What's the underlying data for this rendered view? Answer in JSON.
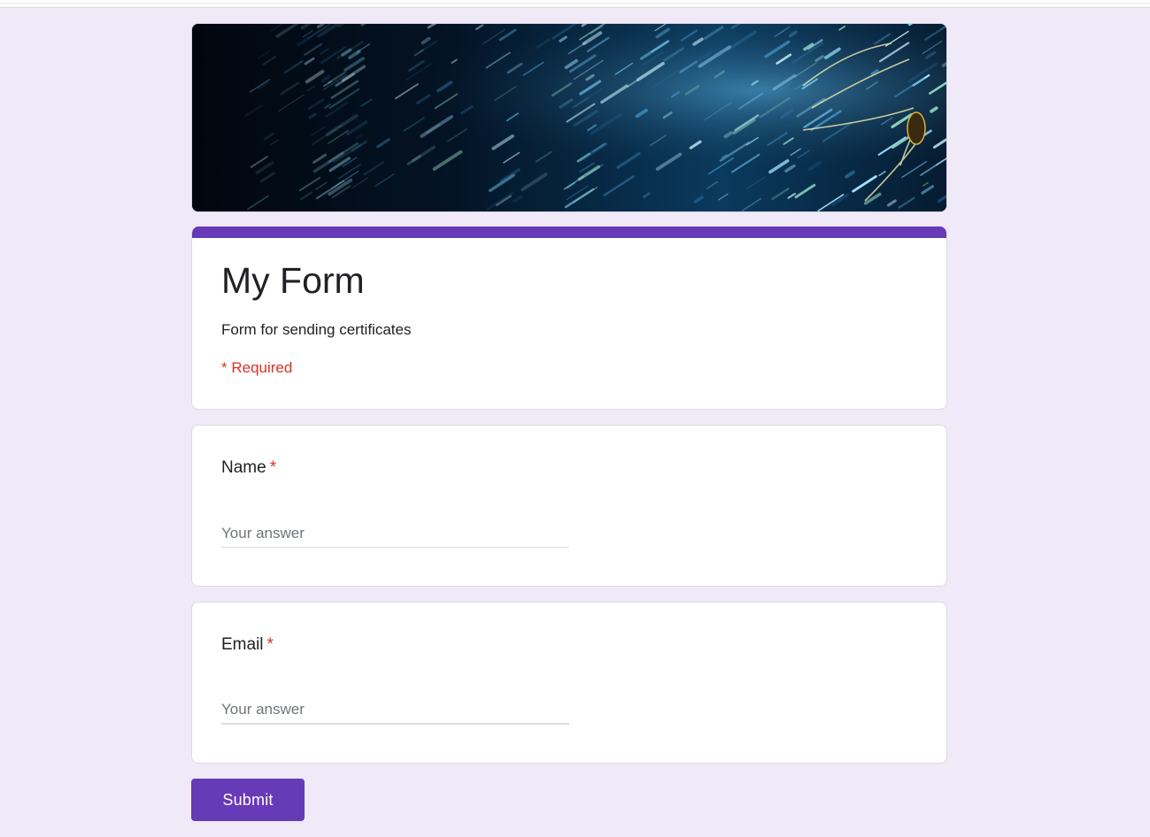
{
  "colors": {
    "accent": "#673ab7",
    "page_background": "#efe9f8",
    "required": "#d93025"
  },
  "header_image": {
    "description": "banner-image"
  },
  "form": {
    "title": "My Form",
    "description": "Form for sending certificates",
    "required_note": "* Required"
  },
  "questions": [
    {
      "label": "Name",
      "required_marker": "*",
      "placeholder": "Your answer",
      "value": ""
    },
    {
      "label": "Email",
      "required_marker": "*",
      "placeholder": "Your answer",
      "value": ""
    }
  ],
  "actions": {
    "submit_label": "Submit"
  }
}
